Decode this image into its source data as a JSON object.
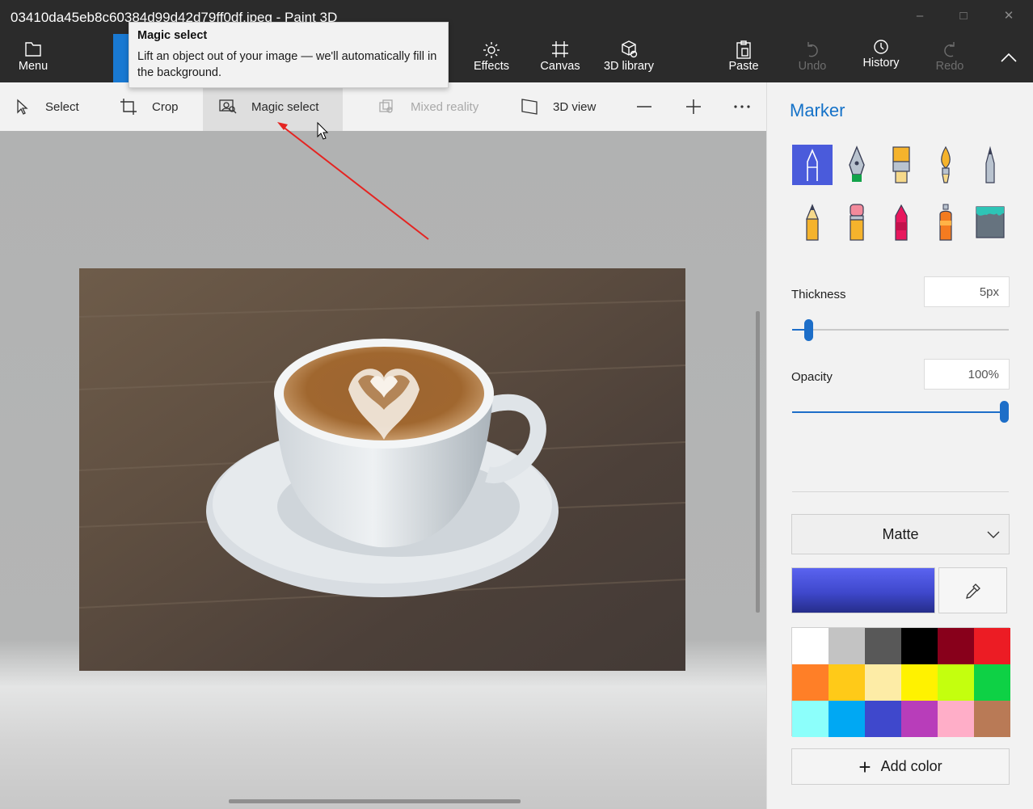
{
  "window": {
    "title": "03410da45eb8c60384d99d42d79ff0df.jpeg - Paint 3D"
  },
  "ribbon": {
    "menu": "Menu",
    "effects": "Effects",
    "canvas": "Canvas",
    "library": "3D library",
    "paste": "Paste",
    "undo": "Undo",
    "history": "History",
    "redo": "Redo"
  },
  "toolbar": {
    "select": "Select",
    "crop": "Crop",
    "magic_select": "Magic select",
    "mixed_reality": "Mixed reality",
    "view_3d": "3D view"
  },
  "tooltip": {
    "title": "Magic select",
    "body": "Lift an object out of your image — we'll automatically fill in the background."
  },
  "panel": {
    "title": "Marker",
    "brushes": [
      "marker-icon",
      "calligraphy-pen-icon",
      "oil-brush-icon",
      "watercolor-icon",
      "pixel-pen-icon",
      "pencil-icon",
      "eraser-icon",
      "crayon-icon",
      "spray-can-icon",
      "fill-bucket-icon"
    ],
    "selected_brush": "marker-icon",
    "thickness_label": "Thickness",
    "thickness_value": "5px",
    "thickness_level": 0.06,
    "opacity_label": "Opacity",
    "opacity_value": "100%",
    "opacity_level": 1.0,
    "finish": "Matte",
    "current_color": "#3f48cc",
    "palette": [
      "#ffffff",
      "#c3c3c3",
      "#585858",
      "#000000",
      "#88001b",
      "#ec1c24",
      "#ff7f27",
      "#ffca18",
      "#fdeca6",
      "#fff200",
      "#c4ff0e",
      "#0ed145",
      "#8cfffb",
      "#00a8f3",
      "#3f48cc",
      "#b83dba",
      "#ffaec8",
      "#b97a56"
    ],
    "add_color": "Add color"
  },
  "colors": {
    "accent": "#1572c8",
    "annotation_arrow": "#e52421"
  }
}
